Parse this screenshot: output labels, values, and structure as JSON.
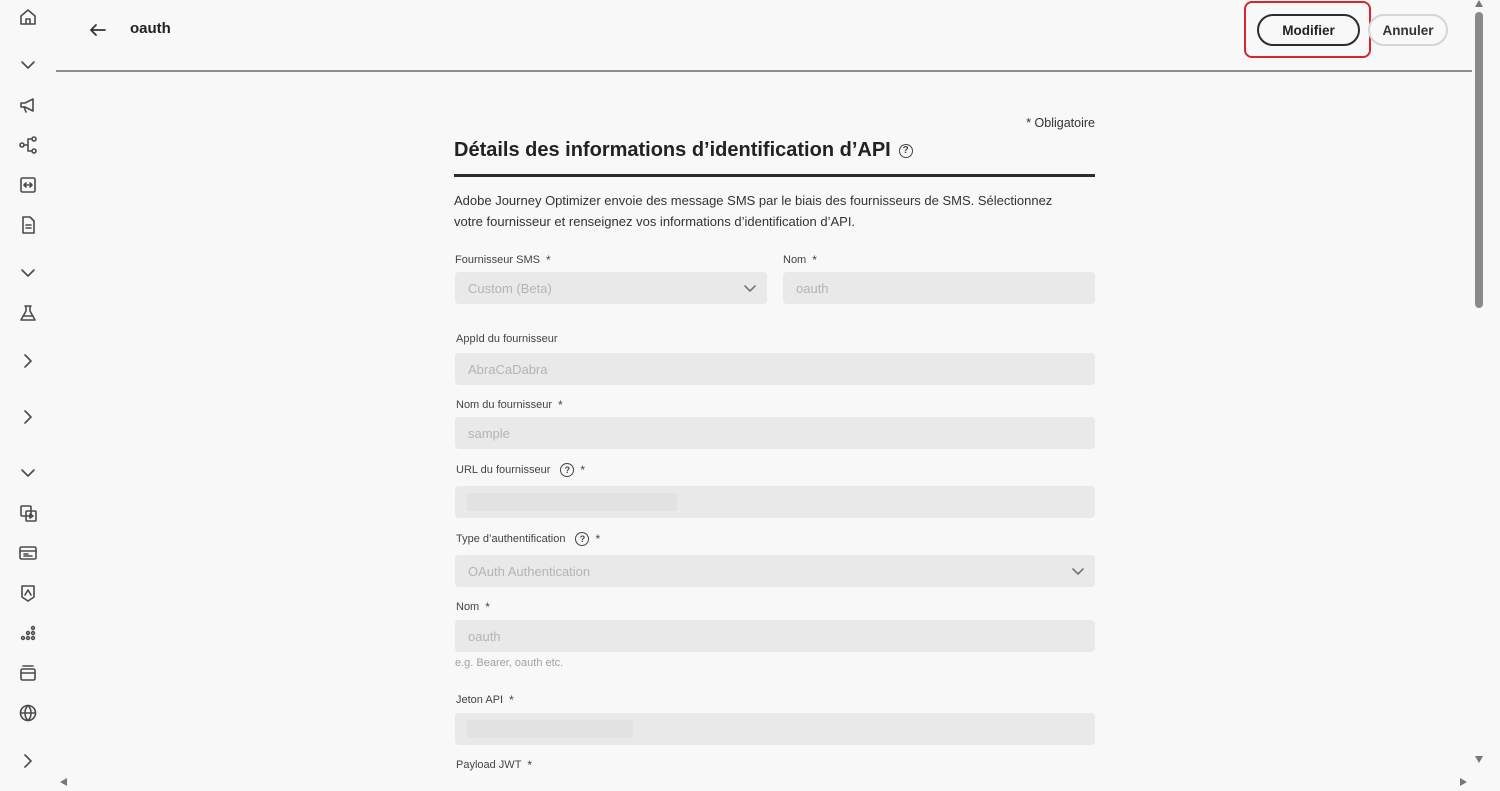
{
  "header": {
    "title": "oauth",
    "modify_label": "Modifier",
    "cancel_label": "Annuler"
  },
  "form": {
    "required_note": "* Obligatoire",
    "section_title": "Détails des informations d’identification d’API",
    "description": "Adobe Journey Optimizer envoie des message SMS par le biais des fournisseurs de SMS. Sélectionnez votre fournisseur et renseignez vos informations d’identification d’API.",
    "fields": {
      "sms_provider": {
        "label": "Fournisseur SMS",
        "value": "Custom (Beta)"
      },
      "name": {
        "label": "Nom",
        "value": "oauth"
      },
      "provider_appid": {
        "label": "AppId du fournisseur",
        "value": "AbraCaDabra"
      },
      "provider_name": {
        "label": "Nom du fournisseur",
        "value": "sample"
      },
      "provider_url": {
        "label": "URL du fournisseur"
      },
      "auth_type": {
        "label": "Type d’authentification",
        "value": "OAuth Authentication"
      },
      "auth_name": {
        "label": "Nom",
        "value": "oauth",
        "helper": "e.g. Bearer, oauth etc."
      },
      "api_token": {
        "label": "Jeton API"
      },
      "jwt_payload": {
        "label": "Payload JWT"
      }
    }
  },
  "icons": {
    "rail": [
      "home-icon",
      "chevron-down-icon",
      "megaphone-icon",
      "journey-icon",
      "split-icon",
      "document-icon",
      "chevron-down-icon",
      "flask-icon",
      "chevron-right-icon",
      "chevron-right-icon",
      "chevron-down-icon",
      "asset-icon",
      "layout-icon",
      "image-icon",
      "dots-icon",
      "stack-icon",
      "globe-icon",
      "chevron-right-icon"
    ]
  },
  "colors": {
    "highlight": "#d7262b",
    "background": "#f8f8f8",
    "field_bg": "#e9e9e9"
  }
}
